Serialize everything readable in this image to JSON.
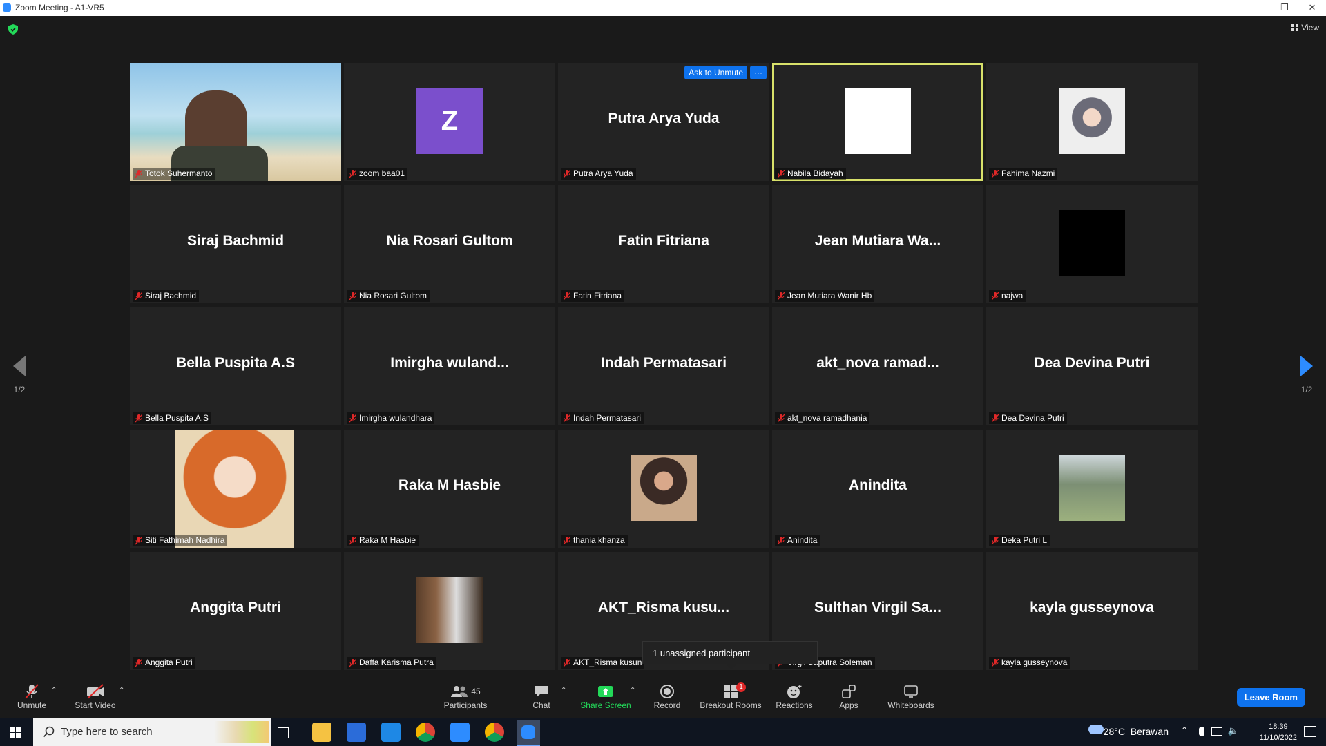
{
  "window": {
    "title": "Zoom Meeting - A1-VR5",
    "minimize": "–",
    "restore": "❐",
    "close": "✕"
  },
  "top": {
    "view_label": "View"
  },
  "grid": {
    "ask_to_unmute": "Ask to Unmute",
    "more": "···",
    "tiles": [
      {
        "big": "",
        "label": "Totok Suhermanto",
        "kind": "video"
      },
      {
        "big": "",
        "label": "zoom baa01",
        "kind": "letter",
        "letter": "Z"
      },
      {
        "big": "Putra Arya Yuda",
        "label": "Putra Arya Yuda",
        "kind": "name"
      },
      {
        "big": "",
        "label": "Nabila Bidayah",
        "kind": "white"
      },
      {
        "big": "",
        "label": "Fahima Nazmi",
        "kind": "photo"
      },
      {
        "big": "Siraj Bachmid",
        "label": "Siraj Bachmid",
        "kind": "name"
      },
      {
        "big": "Nia Rosari Gultom",
        "label": "Nia Rosari Gultom",
        "kind": "name"
      },
      {
        "big": "Fatin Fitriana",
        "label": "Fatin Fitriana",
        "kind": "name"
      },
      {
        "big": "Jean Mutiara Wa...",
        "label": "Jean Mutiara Wanir Hb",
        "kind": "name"
      },
      {
        "big": "",
        "label": "najwa",
        "kind": "black"
      },
      {
        "big": "Bella Puspita A.S",
        "label": "Bella Puspita A.S",
        "kind": "name"
      },
      {
        "big": "Imirgha  wuland...",
        "label": "Imirgha wulandhara",
        "kind": "name"
      },
      {
        "big": "Indah Permatasari",
        "label": "Indah Permatasari",
        "kind": "name"
      },
      {
        "big": "akt_nova  ramad...",
        "label": "akt_nova ramadhania",
        "kind": "name"
      },
      {
        "big": "Dea Devina Putri",
        "label": "Dea Devina Putri",
        "kind": "name"
      },
      {
        "big": "",
        "label": "Siti Fathimah Nadhira",
        "kind": "anime"
      },
      {
        "big": "Raka M Hasbie",
        "label": "Raka M Hasbie",
        "kind": "name"
      },
      {
        "big": "",
        "label": "thania khanza",
        "kind": "photo2"
      },
      {
        "big": "Anindita",
        "label": "Anindita",
        "kind": "name"
      },
      {
        "big": "",
        "label": "Deka Putri L",
        "kind": "photo3"
      },
      {
        "big": "Anggita Putri",
        "label": "Anggita Putri",
        "kind": "name"
      },
      {
        "big": "",
        "label": "Daffa Karisma Putra",
        "kind": "photo4"
      },
      {
        "big": "AKT_Risma  kusu...",
        "label": "AKT_Risma kusun",
        "kind": "name"
      },
      {
        "big": "Sulthan Virgil Sa...",
        "label": "Virgil Saputra Soleman",
        "kind": "name"
      },
      {
        "big": "kayla gusseynova",
        "label": "kayla gusseynova",
        "kind": "name"
      }
    ]
  },
  "paging": {
    "left": "1/2",
    "right": "1/2"
  },
  "tooltip": "1 unassigned participant",
  "toolbar": {
    "unmute": "Unmute",
    "start_video": "Start Video",
    "participants": "Participants",
    "participants_count": "45",
    "chat": "Chat",
    "share_screen": "Share Screen",
    "record": "Record",
    "breakout_rooms": "Breakout Rooms",
    "breakout_badge": "1",
    "reactions": "Reactions",
    "apps": "Apps",
    "whiteboards": "Whiteboards",
    "leave": "Leave Room",
    "accent": "#0e72ed",
    "share_color": "#23d959"
  },
  "taskbar": {
    "search_placeholder": "Type here to search",
    "weather": "28°C  Berawan",
    "time": "18:39",
    "date": "11/10/2022"
  }
}
